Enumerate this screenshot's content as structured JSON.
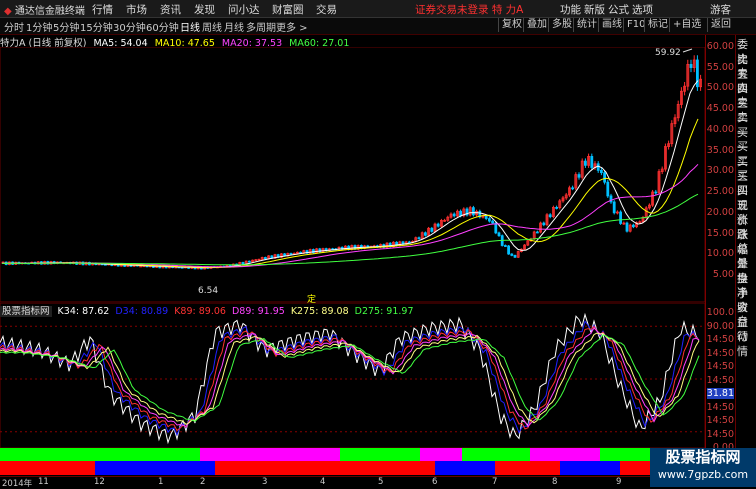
{
  "app": {
    "logo_text": "通达信金融终端"
  },
  "menu": [
    "行情",
    "市场",
    "资讯",
    "发现",
    "问小达",
    "财富圈",
    "交易"
  ],
  "status_title": "证券交易未登录  特 力A",
  "right_menu": [
    "功能",
    "新版",
    "公式",
    "选项",
    "游客"
  ],
  "toolbar": {
    "periods": [
      "分时",
      "1分钟",
      "5分钟",
      "15分钟",
      "30分钟",
      "60分钟",
      "日线",
      "周线",
      "月线",
      "多周期",
      "更多 >"
    ],
    "active": "日线",
    "right_buttons": [
      "复权",
      "叠加",
      "多股",
      "统计",
      "画线",
      "F10",
      "标记",
      "+自选",
      "返回"
    ]
  },
  "ma_legend": {
    "stock": "特力A (日线 前复权)",
    "items": [
      {
        "text": "MA5: 54.04",
        "color": "#ffffff"
      },
      {
        "text": "MA10: 47.65",
        "color": "#ffff00"
      },
      {
        "text": "MA20: 37.53",
        "color": "#ff40ff"
      },
      {
        "text": "MA60: 27.01",
        "color": "#40ff40"
      }
    ]
  },
  "main_chart": {
    "y_ticks": [
      "60.00",
      "55.00",
      "50.00",
      "45.00",
      "40.00",
      "35.00",
      "30.00",
      "25.00",
      "20.00",
      "15.00",
      "10.00",
      "5.00"
    ],
    "high_label": "59.92",
    "low_label": "6.54",
    "marker": "定"
  },
  "side_panel": [
    "委比",
    "卖五",
    "卖四",
    "卖三",
    "卖二",
    "卖一",
    "买一",
    "买二",
    "买三",
    "买四",
    "买五",
    "现价",
    "涨跌",
    "涨幅",
    "总量",
    "外盘",
    "换手",
    "净资",
    "收益",
    "自动",
    "行情"
  ],
  "indicator": {
    "name": "股票指标网",
    "items": [
      {
        "text": "K34: 87.62",
        "color": "#ffffff"
      },
      {
        "text": "D34: 80.89",
        "color": "#2020ff"
      },
      {
        "text": "K89: 89.06",
        "color": "#ff3030"
      },
      {
        "text": "D89: 91.95",
        "color": "#ff40ff"
      },
      {
        "text": "K275: 89.08",
        "color": "#ffff80"
      },
      {
        "text": "D275: 91.97",
        "color": "#40ff40"
      }
    ],
    "y_ticks": [
      "100.0",
      "90.00",
      "14:50",
      "14:50",
      "14:50",
      "14:50",
      "31.81",
      "14:50",
      "14:50",
      "14:50",
      "0.00"
    ],
    "current_value": "31.81"
  },
  "date_axis": [
    "2014年",
    "11",
    "12",
    "1",
    "2",
    "3",
    "4",
    "5",
    "6",
    "7",
    "8",
    "9"
  ],
  "watermark": {
    "title": "股票指标网",
    "url": "www.7gpzb.com"
  },
  "colors": {
    "up": "#ff3030",
    "down": "#00c0ff",
    "axis": "#800000"
  }
}
